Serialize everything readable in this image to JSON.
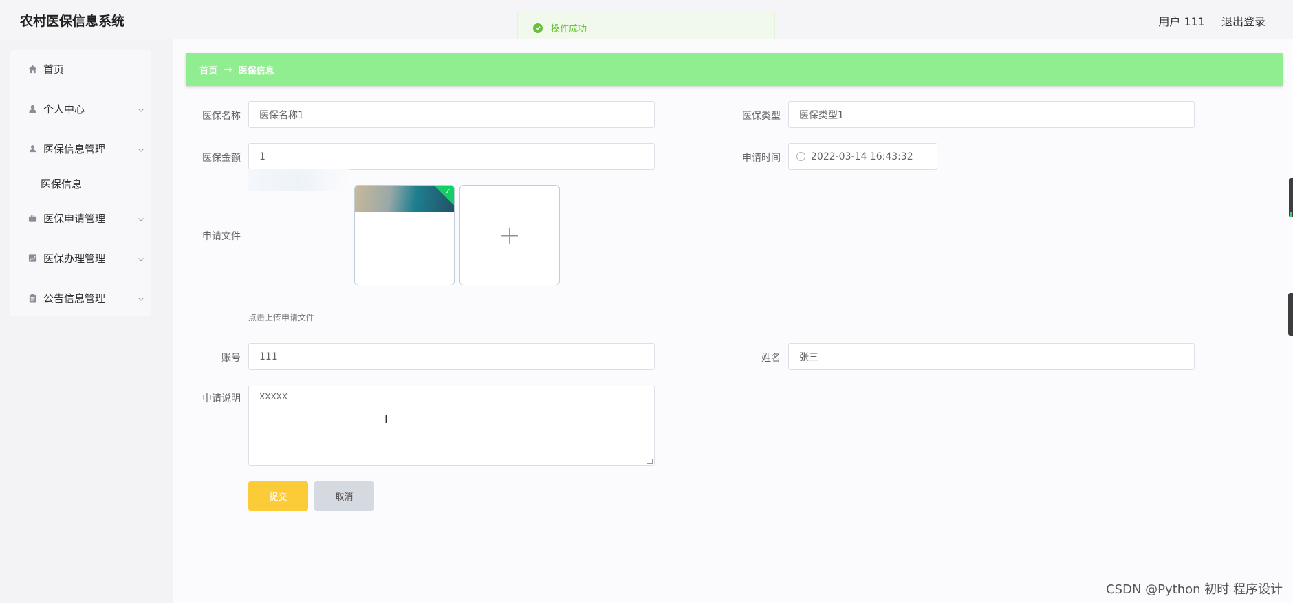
{
  "app": {
    "title": "农村医保信息系统"
  },
  "header": {
    "user": "用户 111",
    "logout": "退出登录"
  },
  "toast": {
    "message": "操作成功",
    "color": "#67c23a"
  },
  "sidebar": {
    "items": [
      {
        "label": "首页",
        "icon": "home-icon"
      },
      {
        "label": "个人中心",
        "icon": "user-icon"
      },
      {
        "label": "医保信息管理",
        "icon": "user-icon"
      },
      {
        "label": "医保信息",
        "icon": ""
      },
      {
        "label": "医保申请管理",
        "icon": "briefcase-icon"
      },
      {
        "label": "医保办理管理",
        "icon": "chart-icon"
      },
      {
        "label": "公告信息管理",
        "icon": "clipboard-icon"
      }
    ]
  },
  "breadcrumb": {
    "home": "首页",
    "separator": "→",
    "current": "医保信息",
    "bg_color": "#90ee90"
  },
  "form": {
    "name": {
      "label": "医保名称",
      "value": "医保名称1"
    },
    "type": {
      "label": "医保类型",
      "value": "医保类型1"
    },
    "amount": {
      "label": "医保金额",
      "value": "1"
    },
    "apply_time": {
      "label": "申请时间",
      "value": "2022-03-14 16:43:32"
    },
    "file": {
      "label": "申请文件",
      "tip": "点击上传申请文件",
      "add_symbol": "+"
    },
    "account": {
      "label": "账号",
      "value": "111"
    },
    "real_name": {
      "label": "姓名",
      "value": "张三"
    },
    "description": {
      "label": "申请说明",
      "value": "XXXXX"
    },
    "submit": {
      "label": "提交",
      "color": "#fccc38"
    },
    "cancel": {
      "label": "取消"
    }
  },
  "watermark": "CSDN @Python 初时 程序设计"
}
